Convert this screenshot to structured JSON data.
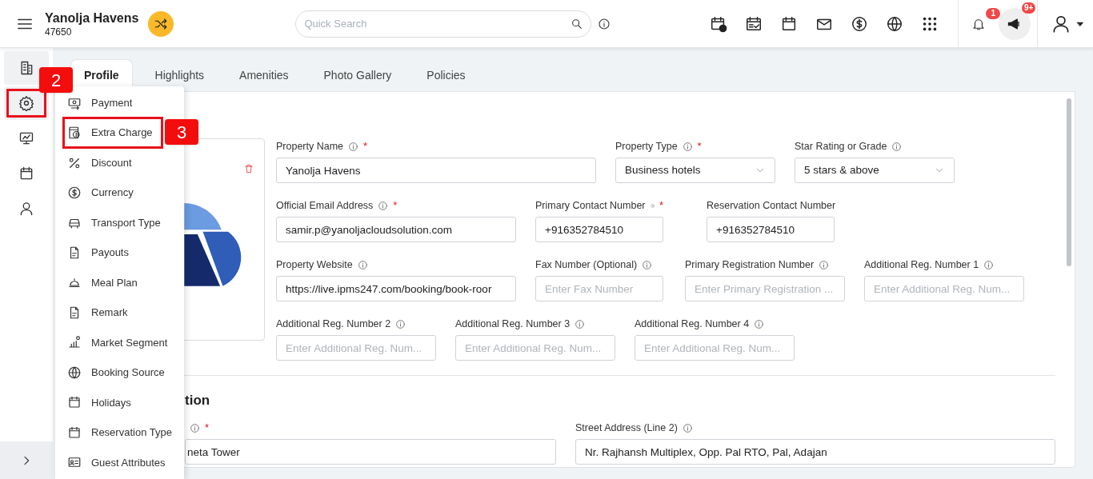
{
  "header": {
    "property_name": "Yanolja Havens",
    "property_code": "47650",
    "search": {
      "placeholder": "Quick Search"
    },
    "notification_count": "1",
    "announcement_count": "9+"
  },
  "rail": [
    {
      "kind": "building",
      "highlighted": false
    },
    {
      "kind": "gear",
      "highlighted": true
    },
    {
      "kind": "monitor",
      "highlighted": false
    },
    {
      "kind": "calendar",
      "highlighted": false
    },
    {
      "kind": "person",
      "highlighted": false
    }
  ],
  "tabs": [
    {
      "label": "Profile",
      "selected": true
    },
    {
      "label": "Highlights",
      "selected": false
    },
    {
      "label": "Amenities",
      "selected": false
    },
    {
      "label": "Photo Gallery",
      "selected": false
    },
    {
      "label": "Policies",
      "selected": false
    }
  ],
  "settings_menu": [
    {
      "label": "Payment",
      "kind": "payment",
      "highlighted": false
    },
    {
      "label": "Extra Charge",
      "kind": "extra",
      "highlighted": true
    },
    {
      "label": "Discount",
      "kind": "percent",
      "highlighted": false
    },
    {
      "label": "Currency",
      "kind": "dollar",
      "highlighted": false
    },
    {
      "label": "Transport Type",
      "kind": "car",
      "highlighted": false
    },
    {
      "label": "Payouts",
      "kind": "doc",
      "highlighted": false
    },
    {
      "label": "Meal Plan",
      "kind": "cloche",
      "highlighted": false
    },
    {
      "label": "Remark",
      "kind": "doc",
      "highlighted": false
    },
    {
      "label": "Market Segment",
      "kind": "chart",
      "highlighted": false
    },
    {
      "label": "Booking Source",
      "kind": "globe",
      "highlighted": false
    },
    {
      "label": "Holidays",
      "kind": "calendar",
      "highlighted": false
    },
    {
      "label": "Reservation Type",
      "kind": "calendar",
      "highlighted": false
    },
    {
      "label": "Guest Attributes",
      "kind": "card",
      "highlighted": false
    }
  ],
  "annotations": [
    {
      "label": "2"
    },
    {
      "label": "3"
    }
  ],
  "form_rows": [
    [
      {
        "label": "Property Name",
        "required_mark": "*",
        "kind": "text",
        "value": "Yanolja Havens"
      },
      {
        "label": "Property Type",
        "required_mark": "*",
        "kind": "select",
        "value": "Business hotels"
      },
      {
        "label": "Star Rating or Grade",
        "kind": "select",
        "value": "5 stars & above"
      }
    ],
    [
      {
        "label": "Official Email Address",
        "required_mark": "*",
        "kind": "text",
        "value": "samir.p@yanoljacloudsolution.com"
      },
      {
        "label": "Primary Contact Number",
        "required_mark": "*",
        "kind": "text",
        "value": "+916352784510"
      },
      {
        "label": "Reservation Contact Number",
        "kind": "text",
        "value": "+916352784510"
      }
    ],
    [
      {
        "label": "Property Website",
        "kind": "text",
        "value": "https://live.ipms247.com/booking/book-roor"
      },
      {
        "label": "Fax Number (Optional)",
        "kind": "text",
        "placeholder": "Enter Fax Number"
      },
      {
        "label": "Primary Registration Number",
        "kind": "text",
        "placeholder": "Enter Primary Registration ..."
      },
      {
        "label": "Additional Reg. Number 1",
        "kind": "text",
        "placeholder": "Enter Additional Reg. Num..."
      }
    ],
    [
      {
        "label": "Additional Reg. Number 2",
        "kind": "text",
        "placeholder": "Enter Additional Reg. Num..."
      },
      {
        "label": "Additional Reg. Number 3",
        "kind": "text",
        "placeholder": "Enter Additional Reg. Num..."
      },
      {
        "label": "Additional Reg. Number 4",
        "kind": "text",
        "placeholder": "Enter Additional Reg. Num..."
      }
    ]
  ],
  "address_section": {
    "heading": "tion",
    "line1": {
      "required_mark": "*",
      "value": "neta Tower"
    },
    "line2": {
      "label": "Street Address (Line 2)",
      "value": "Nr. Rajhansh Multiplex, Opp. Pal RTO, Pal, Adajan"
    }
  }
}
